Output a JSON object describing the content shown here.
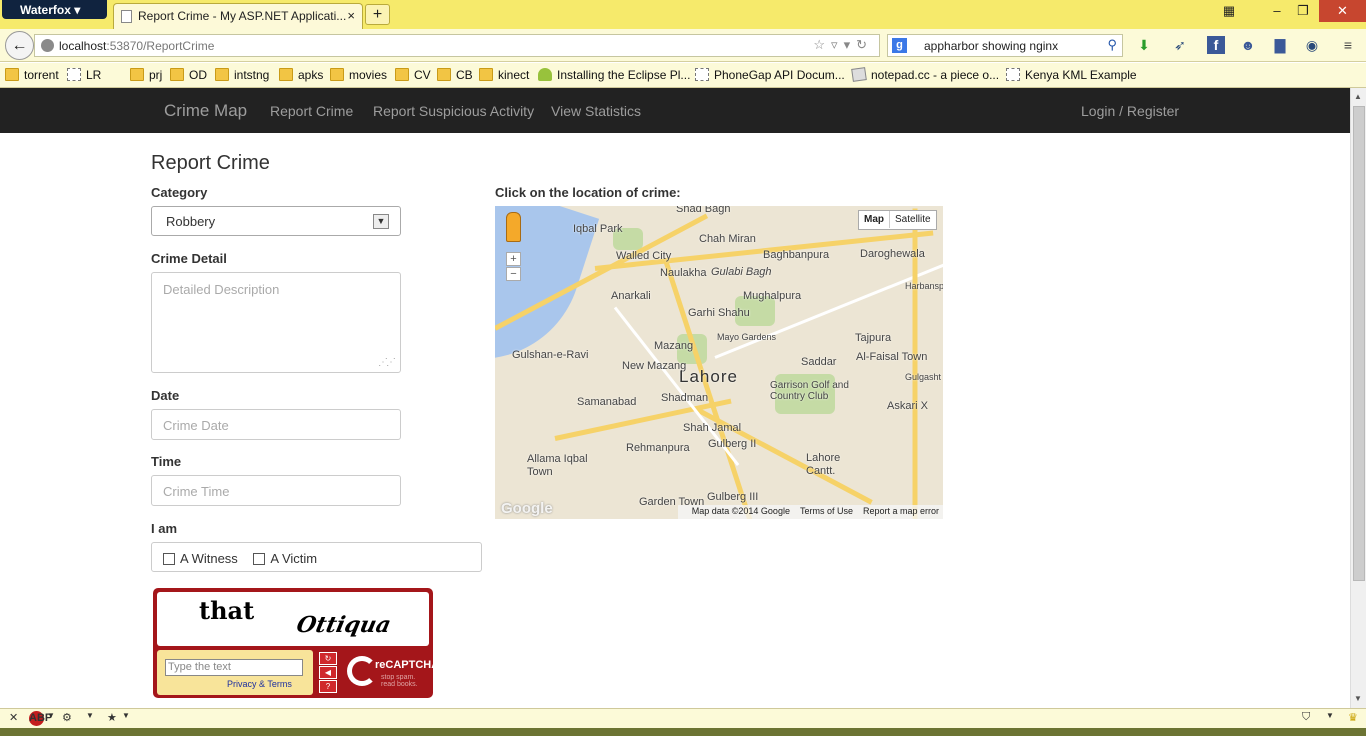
{
  "browser": {
    "app_menu": "Waterfox",
    "tab_title": "Report Crime - My ASP.NET Applicati...",
    "tab_close": "×",
    "new_tab": "+",
    "url_host": "localhost",
    "url_path": ":53870/ReportCrime",
    "search_engine": "g",
    "search_text": "appharbor showing nginx"
  },
  "bookmarks": [
    {
      "label": "torrent",
      "icon": "folder-icon"
    },
    {
      "label": "LR",
      "icon": "folder-icon"
    },
    {
      "label": "prj",
      "icon": "folder-icon"
    },
    {
      "label": "OD",
      "icon": "folder-icon"
    },
    {
      "label": "intstng",
      "icon": "folder-icon"
    },
    {
      "label": "apks",
      "icon": "folder-icon"
    },
    {
      "label": "movies",
      "icon": "folder-icon"
    },
    {
      "label": "CV",
      "icon": "folder-icon"
    },
    {
      "label": "CB",
      "icon": "folder-icon"
    },
    {
      "label": "kinect",
      "icon": "folder-icon"
    },
    {
      "label": "Installing the Eclipse Pl...",
      "icon": "android-icon"
    },
    {
      "label": "PhoneGap API Docum...",
      "icon": "page-icon"
    },
    {
      "label": "notepad.cc - a piece o...",
      "icon": "notepad-icon"
    },
    {
      "label": "Kenya KML Example",
      "icon": "page-icon"
    }
  ],
  "site_nav": {
    "brand": "Crime Map",
    "links": [
      "Report Crime",
      "Report Suspicious Activity",
      "View Statistics"
    ],
    "login": "Login / Register"
  },
  "form": {
    "title": "Report Crime",
    "category_label": "Category",
    "category_value": "Robbery",
    "detail_label": "Crime Detail",
    "detail_placeholder": "Detailed Description",
    "date_label": "Date",
    "date_placeholder": "Crime Date",
    "time_label": "Time",
    "time_placeholder": "Crime Time",
    "iam_label": "I am",
    "witness_label": "A Witness",
    "victim_label": "A Victim"
  },
  "captcha": {
    "word1": "that",
    "word2": "Ottiqua",
    "input_placeholder": "Type the text",
    "privacy": "Privacy & Terms",
    "brand": "reCAPTCHA",
    "tagline1": "stop spam.",
    "tagline2": "read books."
  },
  "map": {
    "label": "Click on the location of crime:",
    "type_map": "Map",
    "type_satellite": "Satellite",
    "zoom_in": "+",
    "zoom_out": "−",
    "city": "Lahore",
    "places": [
      "Shad Bagh",
      "Iqbal Park",
      "Chah Miran",
      "Walled City",
      "Naulakha",
      "Gulabi Bagh",
      "Baghbanpura",
      "Daroghewala",
      "Anarkali",
      "Mughalpura",
      "Garhi Shahu",
      "Mayo Gardens",
      "Tajpura",
      "Mazang",
      "Gulshan-e-Ravi",
      "New Mazang",
      "Saddar",
      "Al-Faisal Town",
      "Garrison Golf and Country Club",
      "Samanabad",
      "Shadman",
      "Askari X",
      "Shah Jamal",
      "Gulberg II",
      "Rehmanpura",
      "Allama Iqbal Town",
      "Lahore Cantt.",
      "Garden Town",
      "Gulberg III",
      "Harbanspura",
      "Gulgasht Town"
    ],
    "attribution": "Map data ©2014 Google",
    "terms": "Terms of Use",
    "report": "Report a map error",
    "logo": "Google"
  }
}
